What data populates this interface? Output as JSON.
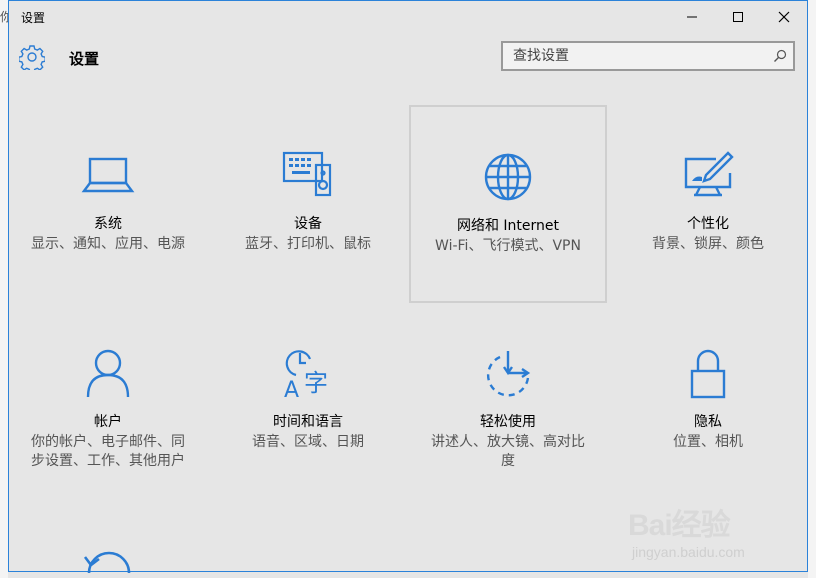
{
  "window": {
    "title": "设置"
  },
  "header": {
    "title": "设置"
  },
  "search": {
    "placeholder": "查找设置"
  },
  "tiles": [
    {
      "label": "系统",
      "desc": "显示、通知、应用、电源"
    },
    {
      "label": "设备",
      "desc": "蓝牙、打印机、鼠标"
    },
    {
      "label": "网络和 Internet",
      "desc": "Wi-Fi、飞行模式、VPN"
    },
    {
      "label": "个性化",
      "desc": "背景、锁屏、颜色"
    },
    {
      "label": "帐户",
      "desc": "你的帐户、电子邮件、同步设置、工作、其他用户"
    },
    {
      "label": "时间和语言",
      "desc": "语音、区域、日期"
    },
    {
      "label": "轻松使用",
      "desc": "讲述人、放大镜、高对比度"
    },
    {
      "label": "隐私",
      "desc": "位置、相机"
    }
  ],
  "background": {
    "left_char": "你"
  },
  "watermark": {
    "brand": "Bai经验",
    "url": "jingyan.baidu.com"
  },
  "colors": {
    "accent": "#2b7cd3",
    "border": "#2b82d9"
  }
}
